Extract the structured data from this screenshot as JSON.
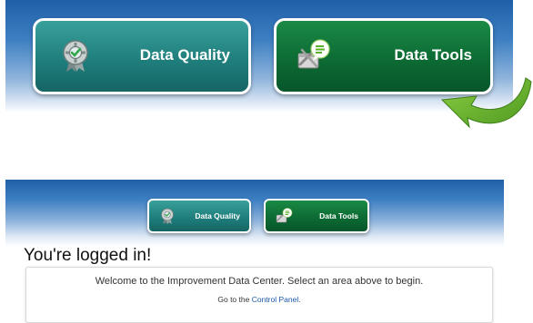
{
  "zoomed": {
    "tiles": [
      {
        "label": "Data Quality",
        "icon": "award-gear-icon"
      },
      {
        "label": "Data Tools",
        "icon": "tools-chat-icon"
      }
    ],
    "arrow_icon": "curved-arrow-icon"
  },
  "page": {
    "tiles": [
      {
        "label": "Data Quality",
        "icon": "award-gear-icon"
      },
      {
        "label": "Data Tools",
        "icon": "tools-chat-icon"
      }
    ],
    "heading": "You're logged in!",
    "welcome": "Welcome to the Improvement Data Center. Select an area above to begin.",
    "goto_prefix": "Go to the ",
    "goto_link": "Control Panel",
    "goto_suffix": "."
  },
  "colors": {
    "band_top": "#1f5fa8",
    "data_quality_tile": "#1f7f7d",
    "data_tools_tile": "#0d6b33",
    "arrow": "#6fb52c",
    "link": "#1a58a8"
  }
}
